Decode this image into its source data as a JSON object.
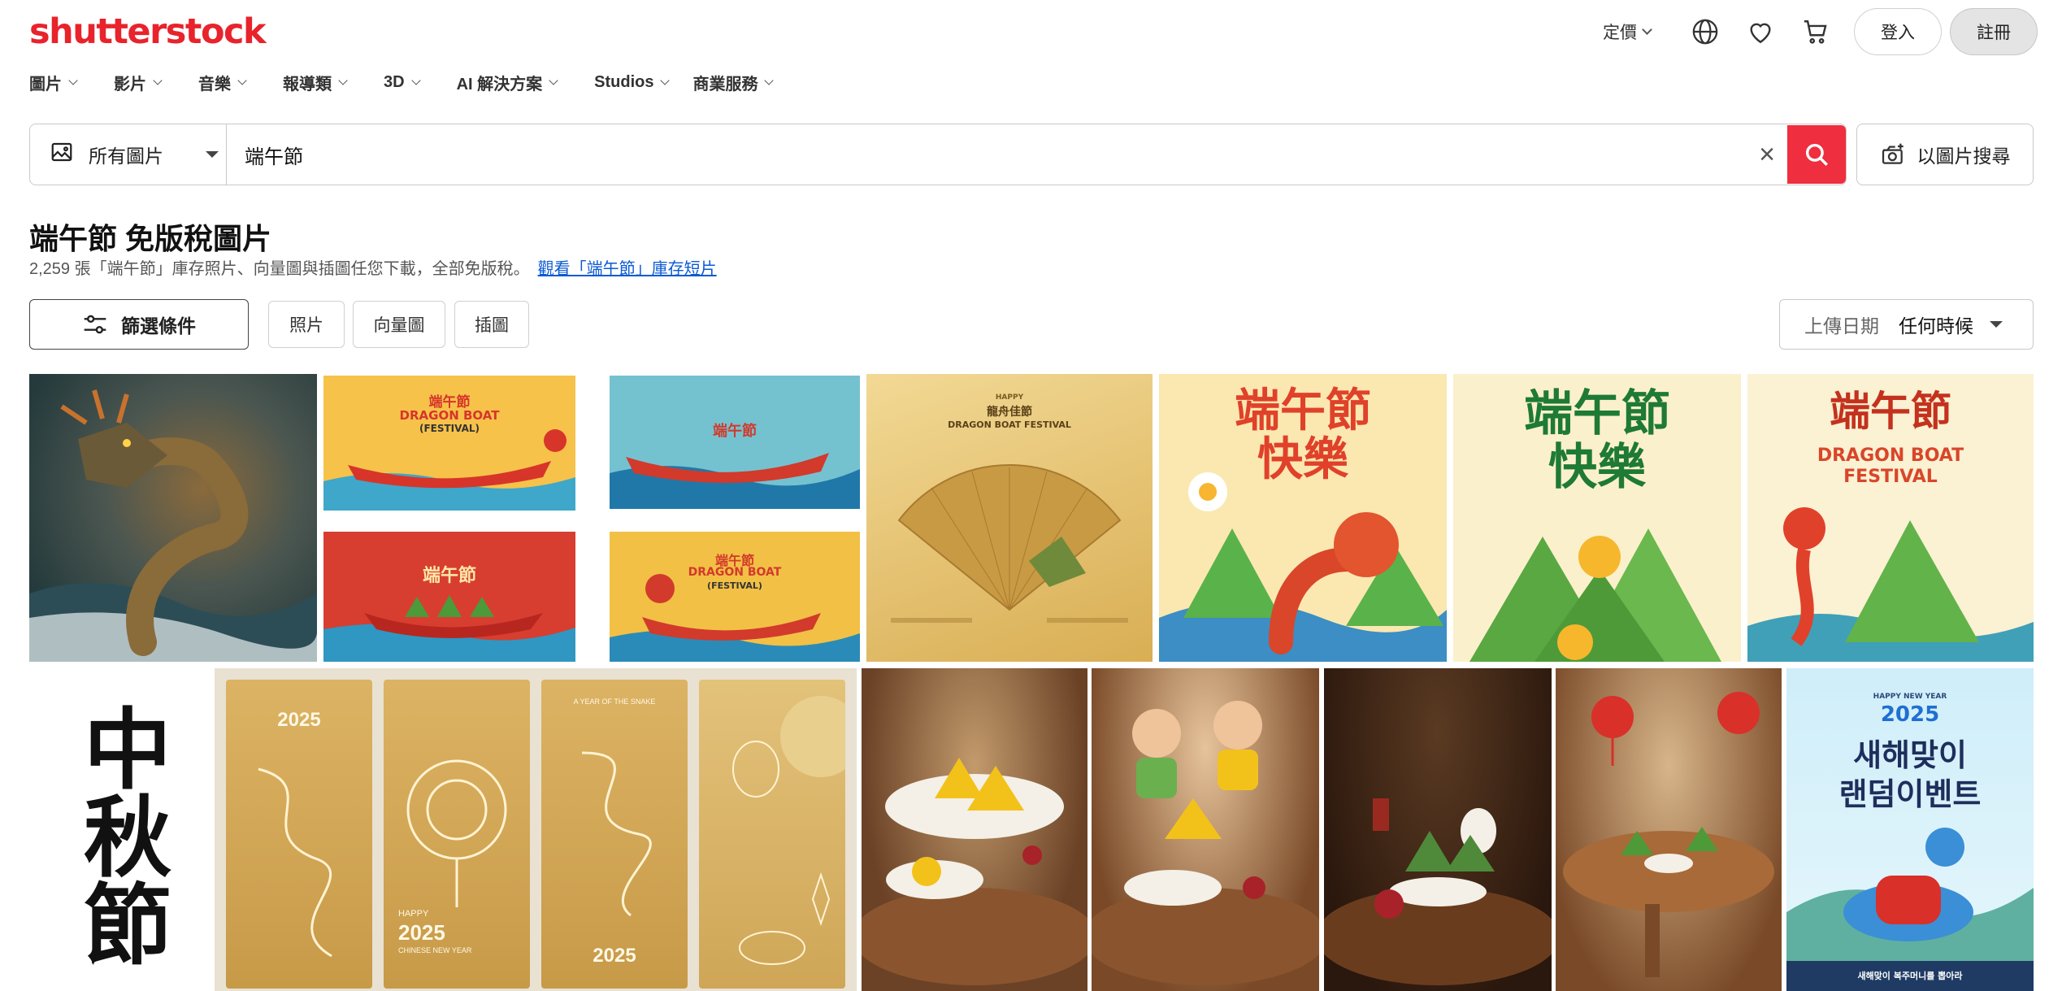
{
  "header": {
    "logo": "shutterstock",
    "pricing": "定價",
    "login": "登入",
    "register": "註冊"
  },
  "nav": [
    {
      "label": "圖片"
    },
    {
      "label": "影片"
    },
    {
      "label": "音樂"
    },
    {
      "label": "報導類"
    },
    {
      "label": "3D"
    },
    {
      "label": "AI 解決方案"
    },
    {
      "label": "Studios"
    },
    {
      "label": "商業服務"
    }
  ],
  "search": {
    "type_label": "所有圖片",
    "query": "端午節",
    "image_search_label": "以圖片搜尋"
  },
  "results": {
    "title": "端午節 免版稅圖片",
    "summary": "2,259 張「端午節」庫存照片、向量圖與插圖任您下載，全部免版稅。",
    "video_link": "觀看「端午節」庫存短片"
  },
  "filters": {
    "filter_button": "篩選條件",
    "chips": [
      "照片",
      "向量圖",
      "插圖"
    ],
    "sort_label": "上傳日期",
    "sort_value": "任何時候"
  },
  "tiles": {
    "t2_title": "端午節",
    "t2_sub": "DRAGON BOAT",
    "t2_sub2": "(FESTIVAL)",
    "t3_title": "端午節",
    "t4_title": "端午節",
    "t5_title": "端午節",
    "t5_sub": "DRAGON BOAT",
    "t5_sub2": "(FESTIVAL)",
    "t6_small": "HAPPY",
    "t6_cn": "龍舟佳節",
    "t6_en": "DRAGON BOAT FESTIVAL",
    "t7_l1": "端午節",
    "t7_l2": "快樂",
    "t8_l1": "端午節",
    "t8_l2": "快樂",
    "t9_l1": "端午節",
    "t9_l2": "DRAGON BOAT",
    "t9_l3": "FESTIVAL",
    "t10_text": "中秋節",
    "t11_y1": "2025",
    "t11_happy": "HAPPY",
    "t11_y2": "2025",
    "t11_cny": "CHINESE NEW YEAR",
    "t11_snake": "A YEAR OF THE SNAKE",
    "t11_y3": "2025",
    "t16_small": "HAPPY NEW YEAR",
    "t16_year": "2025",
    "t16_l1": "새해맞이",
    "t16_l2": "랜덤이벤트",
    "t16_foot": "새해맞이 복주머니를 뽑아라"
  },
  "colors": {
    "brand": "#e8232c",
    "search_button": "#ef2e3f",
    "link": "#0a5ad4"
  }
}
